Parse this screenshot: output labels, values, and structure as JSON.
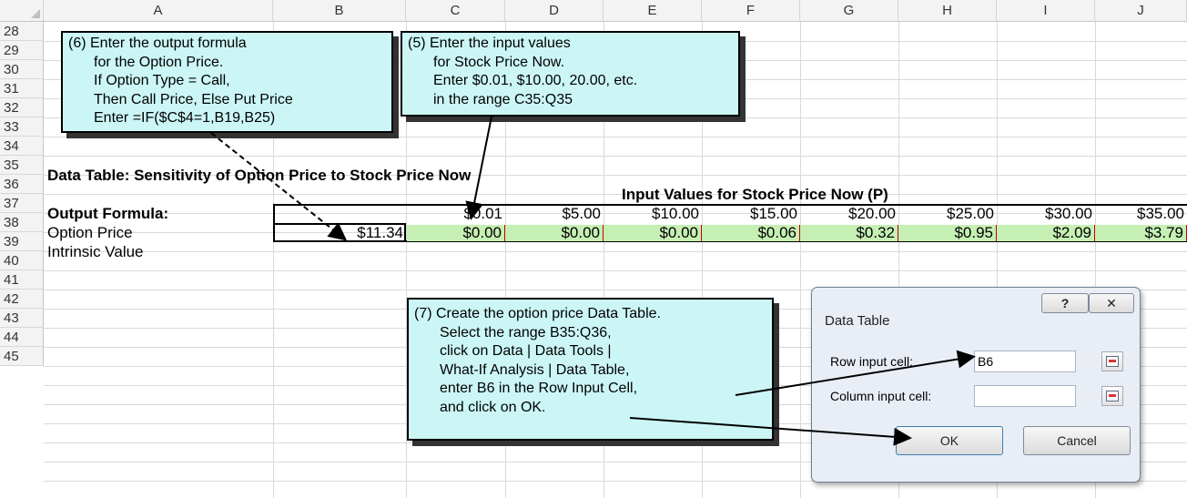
{
  "columns": [
    "A",
    "B",
    "C",
    "D",
    "E",
    "F",
    "G",
    "H",
    "I",
    "J"
  ],
  "rows": [
    "28",
    "29",
    "30",
    "31",
    "32",
    "33",
    "34",
    "35",
    "36",
    "37",
    "38",
    "39",
    "40",
    "41",
    "42",
    "43",
    "44",
    "45"
  ],
  "sheet": {
    "a33": "Data Table: Sensitivity of Option Price to Stock Price Now",
    "input_header": "Input Values for Stock Price Now (P)",
    "a35": "Output Formula:",
    "a36": "Option Price",
    "a37": "Intrinsic Value",
    "b36": "$11.34",
    "row35": [
      "$0.01",
      "$5.00",
      "$10.00",
      "$15.00",
      "$20.00",
      "$25.00",
      "$30.00",
      "$35.00"
    ],
    "row36": [
      "$0.00",
      "$0.00",
      "$0.00",
      "$0.06",
      "$0.32",
      "$0.95",
      "$2.09",
      "$3.79"
    ]
  },
  "callout6": {
    "lines": [
      "(6) Enter the output formula",
      "for the Option Price.",
      "If Option Type = Call,",
      "Then Call Price, Else Put Price",
      "Enter =IF($C$4=1,B19,B25)"
    ]
  },
  "callout5": {
    "lines": [
      "(5) Enter the input values",
      "for Stock Price Now.",
      "Enter $0.01, $10.00, 20.00, etc.",
      "in the range C35:Q35"
    ]
  },
  "callout7": {
    "lines": [
      "(7) Create the option price Data Table.",
      "Select the range B35:Q36,",
      "click on Data | Data Tools |",
      "What-If Analysis | Data Table,",
      "enter B6 in the Row Input Cell,",
      "and click on OK."
    ]
  },
  "dialog": {
    "title": "Data Table",
    "help_glyph": "?",
    "close_glyph": "✕",
    "row_label": "Row input cell:",
    "row_value": "B6",
    "col_label": "Column input cell:",
    "col_value": "",
    "ok_label": "OK",
    "cancel_label": "Cancel"
  }
}
